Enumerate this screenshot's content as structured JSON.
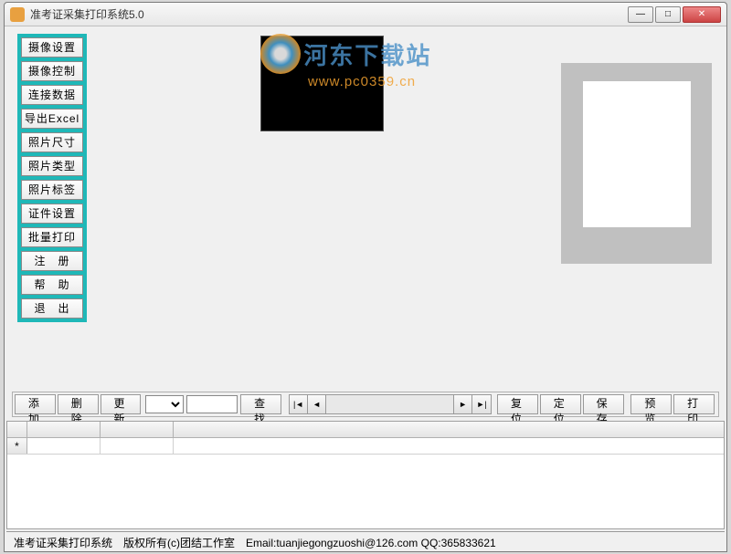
{
  "window": {
    "title": "准考证采集打印系统5.0"
  },
  "sidebar": {
    "buttons": [
      "摄像设置",
      "摄像控制",
      "连接数据",
      "导出Excel",
      "照片尺寸",
      "照片类型",
      "照片标签",
      "证件设置",
      "批量打印",
      "注　册",
      "帮　助",
      "退　出"
    ]
  },
  "watermark": {
    "text1": "河东下载站",
    "text2": "www.pc0359.cn"
  },
  "toolbar": {
    "add": "添 加",
    "delete": "删 除",
    "update": "更 新",
    "search": "查 找",
    "reset": "复 位",
    "locate": "定 位",
    "save": "保 存",
    "preview": "预 览",
    "print": "打 印",
    "select_value": "",
    "input_value": ""
  },
  "grid": {
    "rowmarker": "*"
  },
  "statusbar": {
    "text": "准考证采集打印系统　版权所有(c)团结工作室　Email:tuanjiegongzuoshi@126.com QQ:365833621"
  }
}
